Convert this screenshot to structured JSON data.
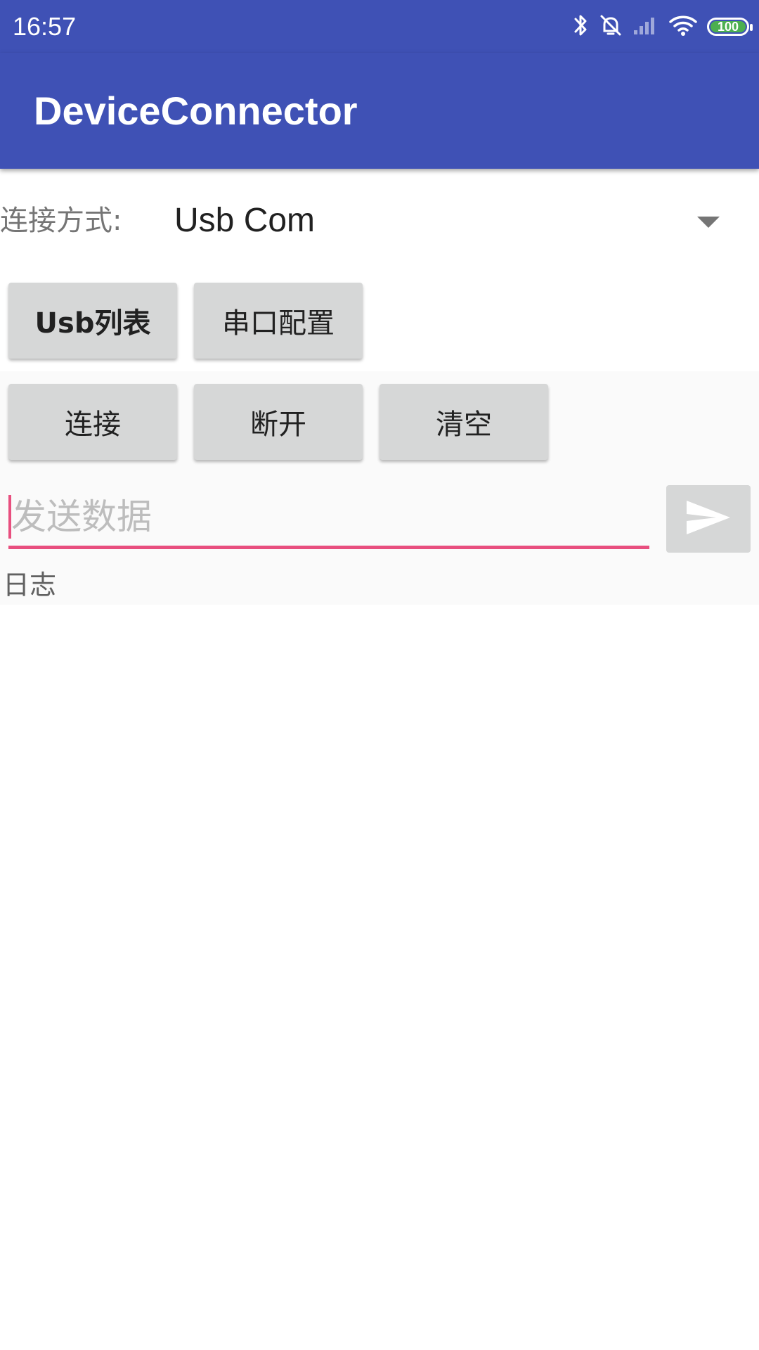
{
  "status_bar": {
    "time": "16:57",
    "icons": [
      "bluetooth-icon",
      "mute-icon",
      "signal-icon",
      "wifi-icon",
      "battery-icon"
    ],
    "battery": "100",
    "battery_color": "#4caf50"
  },
  "app_bar": {
    "title": "DeviceConnector",
    "color": "#3f51b5"
  },
  "connection": {
    "label": "连接方式:",
    "selected": "Usb Com"
  },
  "buttons": {
    "usb_list": "Usb列表",
    "serial_config": "串口配置",
    "connect": "连接",
    "disconnect": "断开",
    "clear": "清空"
  },
  "send": {
    "value": "",
    "placeholder": "发送数据",
    "accent": "#e84f7f"
  },
  "log": {
    "label": "日志"
  }
}
